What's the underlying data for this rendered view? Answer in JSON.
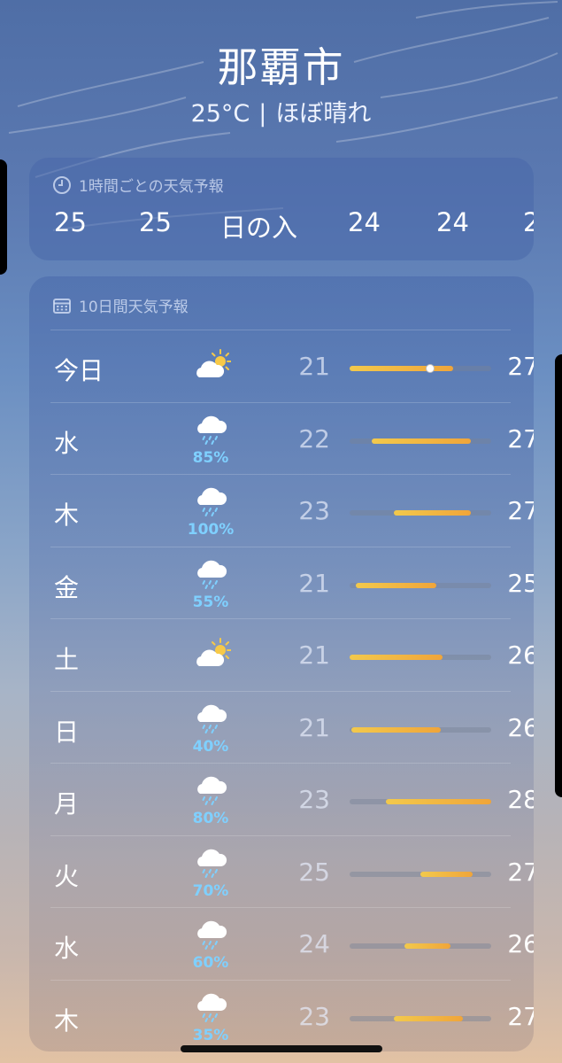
{
  "header": {
    "city": "那覇市",
    "temperature": "25°C",
    "separator": "|",
    "condition": "ほぼ晴れ"
  },
  "hourly": {
    "title": "1時間ごとの天気予報",
    "icon": "clock-icon",
    "items": [
      "25",
      "25",
      "日の入",
      "24",
      "24",
      "2"
    ]
  },
  "daily": {
    "title": "10日間天気予報",
    "icon": "calendar-icon",
    "range_min": 21,
    "range_max": 28,
    "current_temp": 25,
    "rows": [
      {
        "day": "今日",
        "icon": "partly-sunny-icon",
        "precip": "",
        "low": "21",
        "high": "27",
        "bar_low": 21,
        "bar_high": 26.1,
        "now": true
      },
      {
        "day": "水",
        "icon": "rain-cloud-icon",
        "precip": "85%",
        "low": "22",
        "high": "27",
        "bar_low": 22.1,
        "bar_high": 27
      },
      {
        "day": "木",
        "icon": "rain-cloud-icon",
        "precip": "100%",
        "low": "23",
        "high": "27",
        "bar_low": 23.2,
        "bar_high": 27
      },
      {
        "day": "金",
        "icon": "rain-cloud-icon",
        "precip": "55%",
        "low": "21",
        "high": "25",
        "bar_low": 21.3,
        "bar_high": 25.3
      },
      {
        "day": "土",
        "icon": "partly-sunny-icon",
        "precip": "",
        "low": "21",
        "high": "26",
        "bar_low": 21,
        "bar_high": 25.6
      },
      {
        "day": "日",
        "icon": "rain-cloud-icon",
        "precip": "40%",
        "low": "21",
        "high": "26",
        "bar_low": 21.1,
        "bar_high": 25.5
      },
      {
        "day": "月",
        "icon": "rain-cloud-icon",
        "precip": "80%",
        "low": "23",
        "high": "28",
        "bar_low": 22.8,
        "bar_high": 28
      },
      {
        "day": "火",
        "icon": "rain-cloud-icon",
        "precip": "70%",
        "low": "25",
        "high": "27",
        "bar_low": 24.5,
        "bar_high": 27.1
      },
      {
        "day": "水",
        "icon": "rain-cloud-icon",
        "precip": "60%",
        "low": "24",
        "high": "26",
        "bar_low": 23.7,
        "bar_high": 26
      },
      {
        "day": "木",
        "icon": "rain-cloud-icon",
        "precip": "35%",
        "low": "23",
        "high": "27",
        "bar_low": 23.2,
        "bar_high": 26.6
      }
    ]
  },
  "colors": {
    "precip_text": "#7fd0ff",
    "bar_start": "#f2c94c",
    "bar_end": "#f0a53a"
  }
}
